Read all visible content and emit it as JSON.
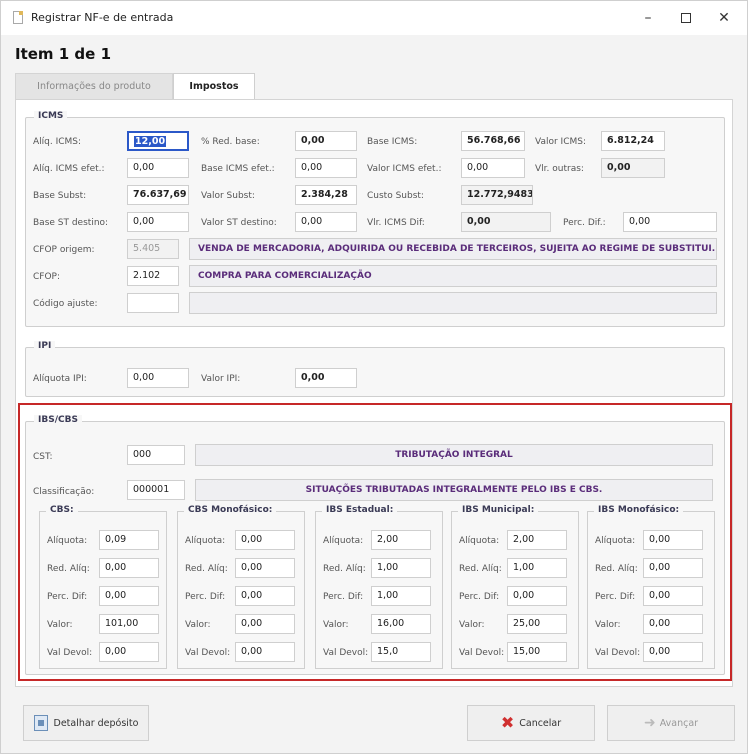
{
  "window": {
    "title": "Registrar NF-e de entrada",
    "min": "–",
    "close": "✕"
  },
  "item_title": "Item 1 de 1",
  "tabs": {
    "info": "Informações do produto",
    "impostos": "Impostos"
  },
  "icms": {
    "label": "ICMS",
    "aliq_icms": {
      "label": "Alíq. ICMS:",
      "value": "12,00"
    },
    "red_base": {
      "label": "% Red. base:",
      "value": "0,00"
    },
    "base_icms": {
      "label": "Base ICMS:",
      "value": "56.768,66"
    },
    "valor_icms": {
      "label": "Valor ICMS:",
      "value": "6.812,24"
    },
    "aliq_efet": {
      "label": "Alíq. ICMS efet.:",
      "value": "0,00"
    },
    "base_efet": {
      "label": "Base ICMS efet.:",
      "value": "0,00"
    },
    "valor_efet": {
      "label": "Valor ICMS efet.:",
      "value": "0,00"
    },
    "vlr_outras": {
      "label": "Vlr. outras:",
      "value": "0,00"
    },
    "base_subst": {
      "label": "Base Subst:",
      "value": "76.637,69"
    },
    "valor_subst": {
      "label": "Valor Subst:",
      "value": "2.384,28"
    },
    "custo_subst": {
      "label": "Custo Subst:",
      "value": "12.772,9483"
    },
    "base_st_destino": {
      "label": "Base ST destino:",
      "value": "0,00"
    },
    "valor_st_destino": {
      "label": "Valor ST destino:",
      "value": "0,00"
    },
    "vlr_icms_dif": {
      "label": "Vlr. ICMS Dif:",
      "value": "0,00"
    },
    "perc_dif": {
      "label": "Perc. Dif.:",
      "value": "0,00"
    },
    "cfop_origem": {
      "label": "CFOP origem:",
      "value": "5.405",
      "desc": "VENDA DE MERCADORIA, ADQUIRIDA OU RECEBIDA DE TERCEIROS, SUJEITA AO REGIME DE SUBSTITUI..."
    },
    "cfop": {
      "label": "CFOP:",
      "value": "2.102",
      "desc": "COMPRA PARA COMERCIALIZAÇÃO"
    },
    "codigo_ajuste": {
      "label": "Código ajuste:",
      "value": "",
      "desc": ""
    }
  },
  "ipi": {
    "label": "IPI",
    "aliquota": {
      "label": "Alíquota IPI:",
      "value": "0,00"
    },
    "valor": {
      "label": "Valor IPI:",
      "value": "0,00"
    }
  },
  "ibscbs": {
    "label": "IBS/CBS",
    "cst": {
      "label": "CST:",
      "value": "000",
      "desc": "TRIBUTAÇÃO INTEGRAL"
    },
    "classificacao": {
      "label": "Classificação:",
      "value": "000001",
      "desc": "SITUAÇÕES TRIBUTADAS INTEGRALMENTE PELO IBS E CBS."
    },
    "row_labels": {
      "aliquota": "Alíquota:",
      "red_aliq": "Red. Alíq:",
      "perc_dif": "Perc. Dif:",
      "valor": "Valor:",
      "val_devol": "Val Devol:"
    },
    "groups": [
      {
        "label": "CBS:",
        "aliquota": "0,09",
        "red_aliq": "0,00",
        "perc_dif": "0,00",
        "valor": "101,00",
        "val_devol": "0,00"
      },
      {
        "label": "CBS Monofásico:",
        "aliquota": "0,00",
        "red_aliq": "0,00",
        "perc_dif": "0,00",
        "valor": "0,00",
        "val_devol": "0,00"
      },
      {
        "label": "IBS Estadual:",
        "aliquota": "2,00",
        "red_aliq": "1,00",
        "perc_dif": "1,00",
        "valor": "16,00",
        "val_devol": "15,0"
      },
      {
        "label": "IBS Municipal:",
        "aliquota": "2,00",
        "red_aliq": "1,00",
        "perc_dif": "0,00",
        "valor": "25,00",
        "val_devol": "15,00"
      },
      {
        "label": "IBS Monofásico:",
        "aliquota": "0,00",
        "red_aliq": "0,00",
        "perc_dif": "0,00",
        "valor": "0,00",
        "val_devol": "0,00"
      }
    ]
  },
  "buttons": {
    "detalhar": "Detalhar depósito",
    "cancelar": "Cancelar",
    "avancar": "Avançar"
  }
}
